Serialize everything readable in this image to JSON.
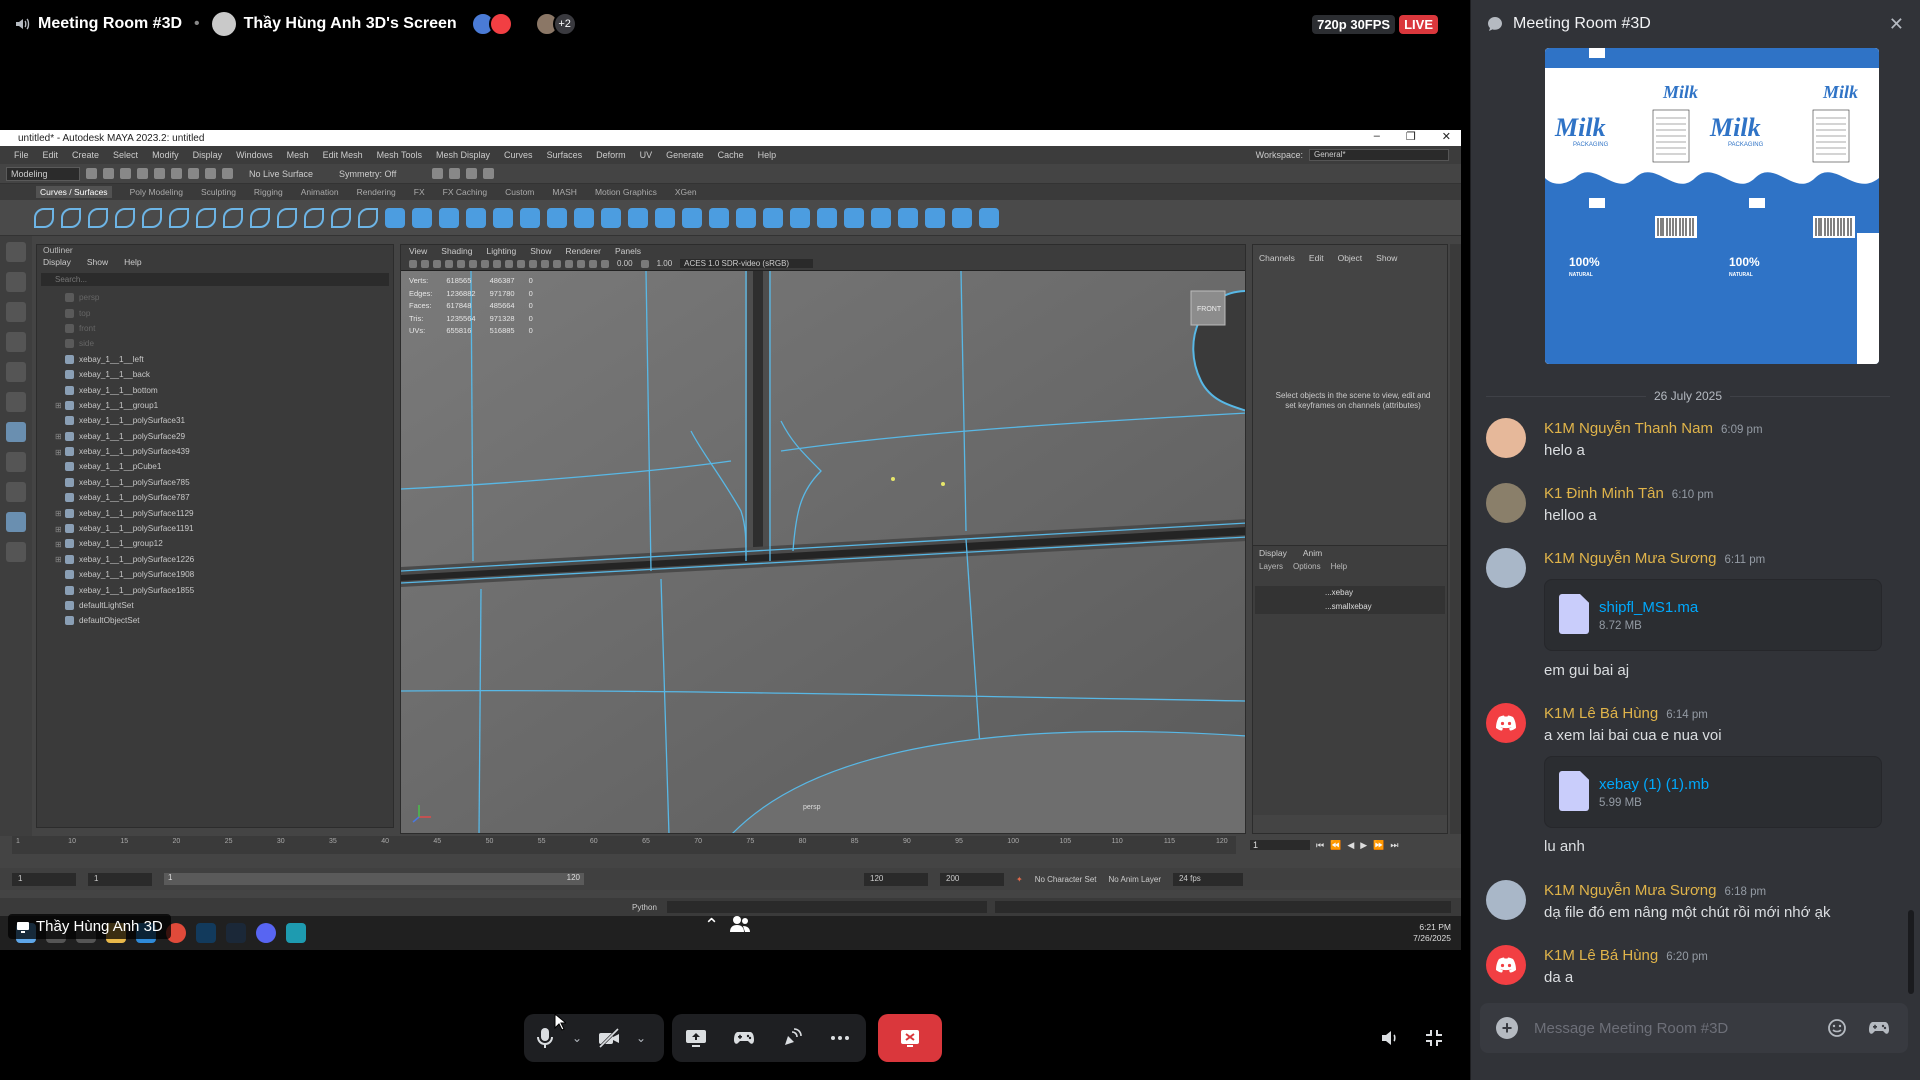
{
  "topbar": {
    "channel": "Meeting Room #3D",
    "screen_title": "Thầy Hùng Anh 3D's Screen",
    "viewer_more": "+2",
    "quality": "720p 30FPS",
    "live": "LIVE"
  },
  "maya": {
    "window_title": "untitled* - Autodesk MAYA 2023.2: untitled",
    "menu": [
      "File",
      "Edit",
      "Create",
      "Select",
      "Modify",
      "Display",
      "Windows",
      "Mesh",
      "Edit Mesh",
      "Mesh Tools",
      "Mesh Display",
      "Curves",
      "Surfaces",
      "Deform",
      "UV",
      "Generate",
      "Cache",
      "Help"
    ],
    "workspace_label": "Workspace:",
    "workspace_value": "General*",
    "mode": "Modeling",
    "no_live_surface": "No Live Surface",
    "symmetry": "Symmetry: Off",
    "shelf_tabs": [
      "Curves / Surfaces",
      "Poly Modeling",
      "Sculpting",
      "Rigging",
      "Animation",
      "Rendering",
      "FX",
      "FX Caching",
      "Custom",
      "MASH",
      "Motion Graphics",
      "XGen"
    ],
    "outliner": {
      "title": "Outliner",
      "menu": [
        "Display",
        "Show",
        "Help"
      ],
      "search": "Search...",
      "items": [
        {
          "label": "persp",
          "dim": true,
          "exp": false
        },
        {
          "label": "top",
          "dim": true,
          "exp": false
        },
        {
          "label": "front",
          "dim": true,
          "exp": false
        },
        {
          "label": "side",
          "dim": true,
          "exp": false
        },
        {
          "label": "xebay_1__1__left",
          "dim": false,
          "exp": false
        },
        {
          "label": "xebay_1__1__back",
          "dim": false,
          "exp": false
        },
        {
          "label": "xebay_1__1__bottom",
          "dim": false,
          "exp": false
        },
        {
          "label": "xebay_1__1__group1",
          "dim": false,
          "exp": true
        },
        {
          "label": "xebay_1__1__polySurface31",
          "dim": false,
          "exp": false
        },
        {
          "label": "xebay_1__1__polySurface29",
          "dim": false,
          "exp": true
        },
        {
          "label": "xebay_1__1__polySurface439",
          "dim": false,
          "exp": true
        },
        {
          "label": "xebay_1__1__pCube1",
          "dim": false,
          "exp": false
        },
        {
          "label": "xebay_1__1__polySurface785",
          "dim": false,
          "exp": false
        },
        {
          "label": "xebay_1__1__polySurface787",
          "dim": false,
          "exp": false
        },
        {
          "label": "xebay_1__1__polySurface1129",
          "dim": false,
          "exp": true
        },
        {
          "label": "xebay_1__1__polySurface1191",
          "dim": false,
          "exp": true
        },
        {
          "label": "xebay_1__1__group12",
          "dim": false,
          "exp": true
        },
        {
          "label": "xebay_1__1__polySurface1226",
          "dim": false,
          "exp": true
        },
        {
          "label": "xebay_1__1__polySurface1908",
          "dim": false,
          "exp": false
        },
        {
          "label": "xebay_1__1__polySurface1855",
          "dim": false,
          "exp": false
        },
        {
          "label": "defaultLightSet",
          "dim": false,
          "exp": false
        },
        {
          "label": "defaultObjectSet",
          "dim": false,
          "exp": false
        }
      ]
    },
    "viewport": {
      "menu": [
        "View",
        "Shading",
        "Lighting",
        "Show",
        "Renderer",
        "Panels"
      ],
      "num1": "0.00",
      "num2": "1.00",
      "colorspace": "ACES 1.0 SDR-video (sRGB)",
      "hud": [
        [
          "Verts:",
          "618565",
          "486387",
          "0"
        ],
        [
          "Edges:",
          "1236882",
          "971780",
          "0"
        ],
        [
          "Faces:",
          "617848",
          "485664",
          "0"
        ],
        [
          "Tris:",
          "1235564",
          "971328",
          "0"
        ],
        [
          "UVs:",
          "655816",
          "516885",
          "0"
        ]
      ],
      "cam_label": "persp",
      "front_label": "FRONT"
    },
    "channelbox": {
      "menu": [
        "Channels",
        "Edit",
        "Object",
        "Show"
      ],
      "message": "Select objects in the scene to view, edit and set keyframes on channels (attributes)",
      "layer_tabs": [
        "Display",
        "Anim"
      ],
      "layer_opts": [
        "Layers",
        "Options",
        "Help"
      ],
      "layers": [
        "...xebay",
        "...smallxebay"
      ]
    },
    "timeslider_ticks": [
      "1",
      "10",
      "15",
      "20",
      "25",
      "30",
      "35",
      "40",
      "45",
      "50",
      "55",
      "60",
      "65",
      "70",
      "75",
      "80",
      "85",
      "90",
      "95",
      "100",
      "105",
      "110",
      "115",
      "120"
    ],
    "current_frame": "1",
    "range": {
      "start": "1",
      "start2": "1",
      "range_start": "1",
      "range_end": "120",
      "end": "120",
      "end2": "200",
      "character_set": "No Character Set",
      "anim_layer": "No Anim Layer",
      "fps": "24 fps"
    },
    "cmd_label": "Python",
    "clock_time": "6:21 PM",
    "clock_date": "7/26/2025"
  },
  "speaker": "Thầy Hùng Anh 3D",
  "chat": {
    "title": "Meeting Room #3D",
    "date_divider": "26 July 2025",
    "messages": [
      {
        "name": "K1M Nguyễn Thanh Nam",
        "time": "6:09 pm",
        "text": "helo a"
      },
      {
        "name": "K1 Đinh Minh Tân",
        "time": "6:10 pm",
        "text": "helloo a"
      },
      {
        "name": "K1M Nguyễn Mưa Sương",
        "time": "6:11 pm",
        "file_name": "shipfl_MS1.ma",
        "file_size": "8.72 MB",
        "text_after": "em gui bai aj"
      },
      {
        "name": "K1M Lê Bá Hùng",
        "time": "6:14 pm",
        "text": "a xem lai bai cua e nua voi",
        "file_name": "xebay (1) (1).mb",
        "file_size": "5.99 MB",
        "text_after": "lu anh"
      },
      {
        "name": "K1M Nguyễn Mưa Sương",
        "time": "6:18 pm",
        "text": "dạ file đó em nâng một chút rồi mới nhớ ạk"
      },
      {
        "name": "K1M Lê Bá Hùng",
        "time": "6:20 pm",
        "text": "da a"
      }
    ],
    "input_placeholder": "Message Meeting Room #3D"
  },
  "milk_image": {
    "brand": "Milk",
    "sub": "PACKAGING",
    "percent": "100%",
    "natural": "NATURAL",
    "colors": {
      "blue": "#2f73c6",
      "light": "#ffffff"
    }
  },
  "colors": {
    "accent_name": "#e0b44a",
    "link": "#00a8fc",
    "leave": "#da373c",
    "discord": "#f23f43"
  }
}
